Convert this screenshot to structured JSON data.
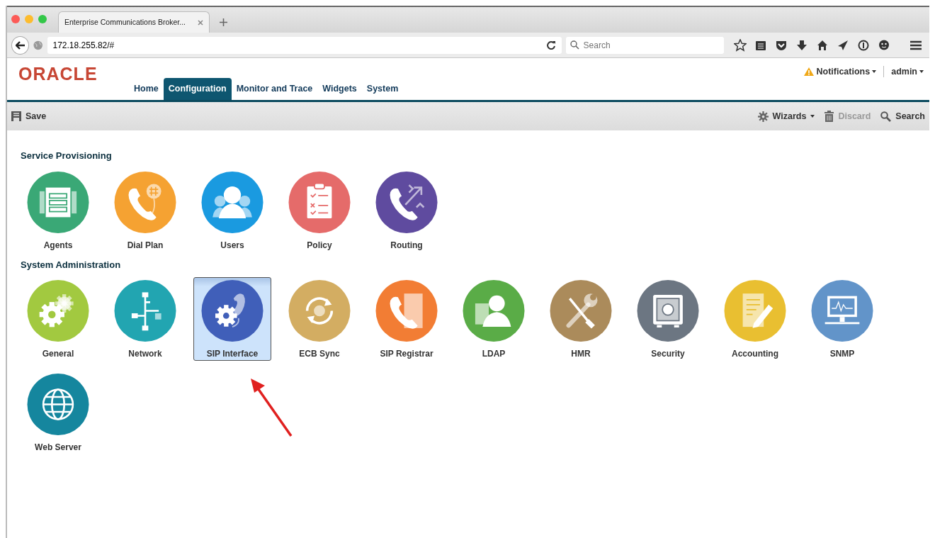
{
  "browser": {
    "tab_title": "Enterprise Communications Broker...",
    "url": "172.18.255.82/#",
    "search_placeholder": "Search"
  },
  "header": {
    "logo": "ORACLE",
    "notifications": "Notifications",
    "user": "admin",
    "nav": [
      {
        "label": "Home",
        "selected": false
      },
      {
        "label": "Configuration",
        "selected": true
      },
      {
        "label": "Monitor and Trace",
        "selected": false
      },
      {
        "label": "Widgets",
        "selected": false
      },
      {
        "label": "System",
        "selected": false
      }
    ]
  },
  "toolbar": {
    "save": "Save",
    "wizards": "Wizards",
    "discard": {
      "label": "Discard",
      "disabled": true
    },
    "search": "Search"
  },
  "sections": [
    {
      "title": "Service Provisioning",
      "tiles": [
        {
          "label": "Agents",
          "color": "#3aa876",
          "selected": false
        },
        {
          "label": "Dial Plan",
          "color": "#f5a232",
          "selected": false
        },
        {
          "label": "Users",
          "color": "#1a9ae0",
          "selected": false
        },
        {
          "label": "Policy",
          "color": "#e56b6a",
          "selected": false
        },
        {
          "label": "Routing",
          "color": "#5f4b9f",
          "selected": false
        }
      ]
    },
    {
      "title": "System Administration",
      "tiles": [
        {
          "label": "General",
          "color": "#a2c940",
          "selected": false
        },
        {
          "label": "Network",
          "color": "#22a5b1",
          "selected": false
        },
        {
          "label": "SIP Interface",
          "color": "#405fb9",
          "selected": true
        },
        {
          "label": "ECB Sync",
          "color": "#d3ad62",
          "selected": false
        },
        {
          "label": "SIP Registrar",
          "color": "#f27d34",
          "selected": false
        },
        {
          "label": "LDAP",
          "color": "#5aac47",
          "selected": false
        },
        {
          "label": "HMR",
          "color": "#ab8b5b",
          "selected": false
        },
        {
          "label": "Security",
          "color": "#6c7682",
          "selected": false
        },
        {
          "label": "Accounting",
          "color": "#e9bf31",
          "selected": false
        },
        {
          "label": "SNMP",
          "color": "#6294c9",
          "selected": false
        },
        {
          "label": "Web Server",
          "color": "#15869e",
          "selected": false
        }
      ]
    }
  ]
}
